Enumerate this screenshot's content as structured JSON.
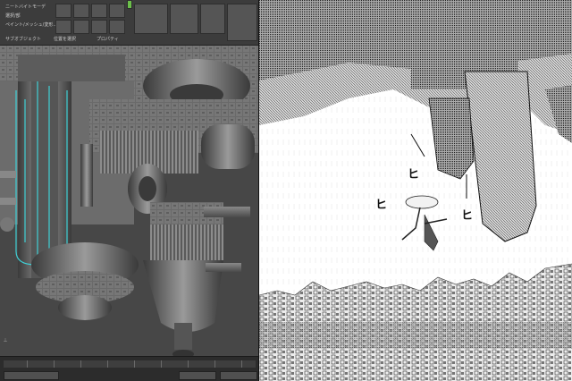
{
  "toolbar": {
    "row1": "ニートバイトモーデ",
    "row2": "選択/部",
    "row3": "ペイント/メッシュ/変形...",
    "sub_left": "サブオブジェクト",
    "sub_mid": "位置を選択",
    "sub_right": "プロパティ"
  },
  "sfx": {
    "a": "ヒ",
    "b": "ヒ",
    "c": "ヒ"
  },
  "colors": {
    "ui_bg": "#3c3c3c",
    "viewport_bg": "#474747",
    "selection": "#3fd0d6"
  }
}
